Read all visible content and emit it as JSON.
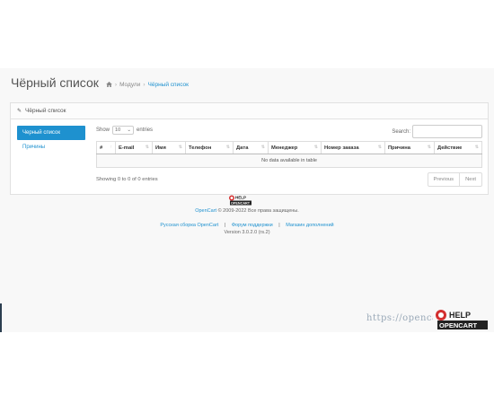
{
  "header": {
    "title": "Чёрный список",
    "breadcrumb": [
      "Модули",
      "Чёрный список"
    ]
  },
  "panel": {
    "heading": "Чёрный список",
    "nav": [
      {
        "label": "Черный список",
        "active": true
      },
      {
        "label": "Причины",
        "active": false
      }
    ]
  },
  "table": {
    "show_label": "Show",
    "length_value": "10",
    "entries_label": "entries",
    "search_label": "Search:",
    "columns": [
      "#",
      "E-mail",
      "Имя",
      "Телефон",
      "Дата",
      "Менеджер",
      "Номер заказа",
      "Причина",
      "Действие"
    ],
    "empty_message": "No data available in table",
    "info": "Showing 0 to 0 of 0 entries",
    "pager": {
      "prev": "Previous",
      "next": "Next"
    }
  },
  "footer": {
    "brand": "OpenCart",
    "copyright": "© 2009-2022 Все права защищены.",
    "links": [
      "Русская сборка OpenCart",
      "Форум поддержки",
      "Магазин дополнений"
    ],
    "separator": "|",
    "version": "Version 3.0.2.0 (rs.2)"
  },
  "watermark": {
    "url": "https://opencart",
    "logo_top": "HELP",
    "logo_bottom": "OPENCART"
  },
  "colors": {
    "accent": "#1e91cf",
    "background": "#f8f8f8",
    "watermark_red": "#d32f2f"
  }
}
